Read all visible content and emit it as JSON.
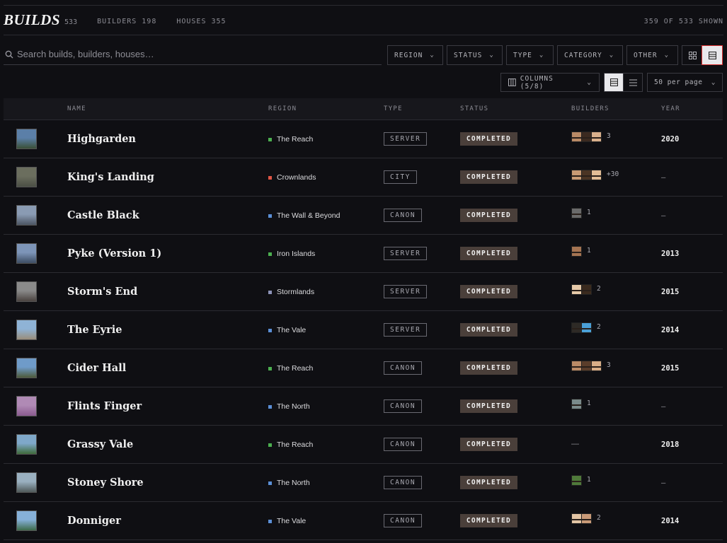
{
  "header": {
    "logo": "BUILDS",
    "logo_count": "533",
    "builders_label": "BUILDERS 198",
    "houses_label": "HOUSES 355",
    "shown_label": "359 OF 533 SHOWN"
  },
  "search": {
    "placeholder": "Search builds, builders, houses…",
    "value": ""
  },
  "filters": [
    {
      "label": "REGION"
    },
    {
      "label": "STATUS"
    },
    {
      "label": "TYPE"
    },
    {
      "label": "CATEGORY"
    },
    {
      "label": "OTHER"
    }
  ],
  "view": {
    "columns_label": "COLUMNS (5/8)",
    "per_page": "50 per page"
  },
  "table": {
    "headers": {
      "name": "NAME",
      "region": "REGION",
      "type": "TYPE",
      "status": "STATUS",
      "builders": "BUILDERS",
      "year": "YEAR"
    },
    "rows": [
      {
        "name": "Highgarden",
        "region": "The Reach",
        "region_color": "#4caf50",
        "type": "SERVER",
        "status": "COMPLETED",
        "builders": "3",
        "avatar_colors": [
          "#b98a66",
          "#3b2a20",
          "#d9b08c"
        ],
        "year": "2020",
        "thumb": [
          "#5b7fa8",
          "#3a4f36"
        ]
      },
      {
        "name": "King's Landing",
        "region": "Crownlands",
        "region_color": "#e05545",
        "type": "CITY",
        "status": "COMPLETED",
        "builders": "+30",
        "avatar_colors": [
          "#c79a74",
          "#4a3424",
          "#e2bd96"
        ],
        "year": "—",
        "thumb": [
          "#6b6e5e",
          "#4b4f45"
        ]
      },
      {
        "name": "Castle Black",
        "region": "The Wall & Beyond",
        "region_color": "#5b8fd6",
        "type": "CANON",
        "status": "COMPLETED",
        "builders": "1",
        "avatar_colors": [
          "#6a6a6a"
        ],
        "year": "—",
        "thumb": [
          "#8a9bb3",
          "#4c5563"
        ]
      },
      {
        "name": "Pyke (Version 1)",
        "region": "Iron Islands",
        "region_color": "#4caf50",
        "type": "SERVER",
        "status": "COMPLETED",
        "builders": "1",
        "avatar_colors": [
          "#a57452"
        ],
        "year": "2013",
        "thumb": [
          "#7d95b8",
          "#3d4d63"
        ]
      },
      {
        "name": "Storm's End",
        "region": "Stormlands",
        "region_color": "#8d93b8",
        "type": "SERVER",
        "status": "COMPLETED",
        "builders": "2",
        "avatar_colors": [
          "#e6c9a8",
          "#3a2a1e"
        ],
        "year": "2015",
        "thumb": [
          "#8a8a8a",
          "#4a4340"
        ]
      },
      {
        "name": "The Eyrie",
        "region": "The Vale",
        "region_color": "#5b8fd6",
        "type": "SERVER",
        "status": "COMPLETED",
        "builders": "2",
        "avatar_colors": [
          "#2e2a26",
          "#4aa0d8"
        ],
        "year": "2014",
        "thumb": [
          "#8fb3d6",
          "#9a8d7a"
        ]
      },
      {
        "name": "Cider Hall",
        "region": "The Reach",
        "region_color": "#4caf50",
        "type": "CANON",
        "status": "COMPLETED",
        "builders": "3",
        "avatar_colors": [
          "#b98a66",
          "#5a3d2a",
          "#d8ae88"
        ],
        "year": "2015",
        "thumb": [
          "#6f9bc9",
          "#4d5a3a"
        ]
      },
      {
        "name": "Flints Finger",
        "region": "The North",
        "region_color": "#5b8fd6",
        "type": "CANON",
        "status": "COMPLETED",
        "builders": "1",
        "avatar_colors": [
          "#7a8a8a"
        ],
        "year": "—",
        "thumb": [
          "#b08ab5",
          "#8a5a8f"
        ]
      },
      {
        "name": "Grassy Vale",
        "region": "The Reach",
        "region_color": "#4caf50",
        "type": "CANON",
        "status": "COMPLETED",
        "builders": "",
        "avatar_colors": [],
        "builders_dash": "—",
        "year": "2018",
        "thumb": [
          "#7fa8c9",
          "#3f6b3a"
        ]
      },
      {
        "name": "Stoney Shore",
        "region": "The North",
        "region_color": "#5b8fd6",
        "type": "CANON",
        "status": "COMPLETED",
        "builders": "1",
        "avatar_colors": [
          "#4f7a3a"
        ],
        "year": "—",
        "thumb": [
          "#9ab0c0",
          "#505a5a"
        ]
      },
      {
        "name": "Donniger",
        "region": "The Vale",
        "region_color": "#5b8fd6",
        "type": "CANON",
        "status": "COMPLETED",
        "builders": "2",
        "avatar_colors": [
          "#e2c4a4",
          "#c99a78"
        ],
        "year": "2014",
        "thumb": [
          "#86b0d8",
          "#3d6b4a"
        ]
      }
    ]
  }
}
